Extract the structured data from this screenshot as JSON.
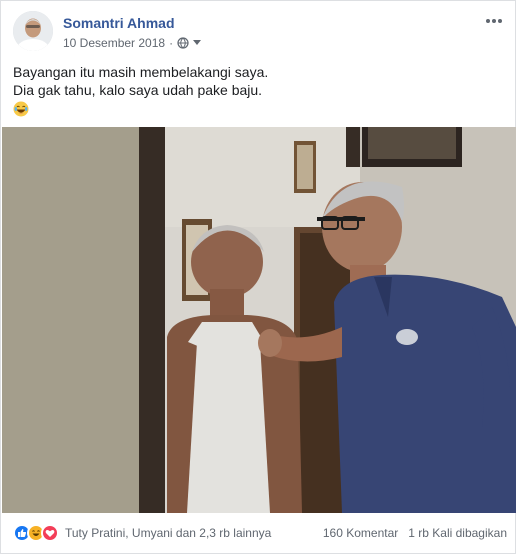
{
  "post": {
    "author": "Somantri Ahmad",
    "date": "10 Desember 2018",
    "privacy_icon": "globe-icon",
    "text_lines": [
      "Bayangan itu masih membelakangi saya.",
      "Dia gak tahu, kalo saya udah pake baju."
    ],
    "emoji": "laughing-tears-emoji"
  },
  "reactions": {
    "icons": [
      "like-reaction",
      "haha-reaction",
      "love-reaction"
    ],
    "names": "Tuty Pratini, Umyani dan 2,3 rb lainnya",
    "comments": "160 Komentar",
    "shares": "1 rb Kali dibagikan"
  },
  "colors": {
    "author_link": "#365899",
    "muted_text": "#606770",
    "like_blue": "#1877f2",
    "haha_yellow": "#f7b125",
    "love_red": "#f33e58"
  }
}
